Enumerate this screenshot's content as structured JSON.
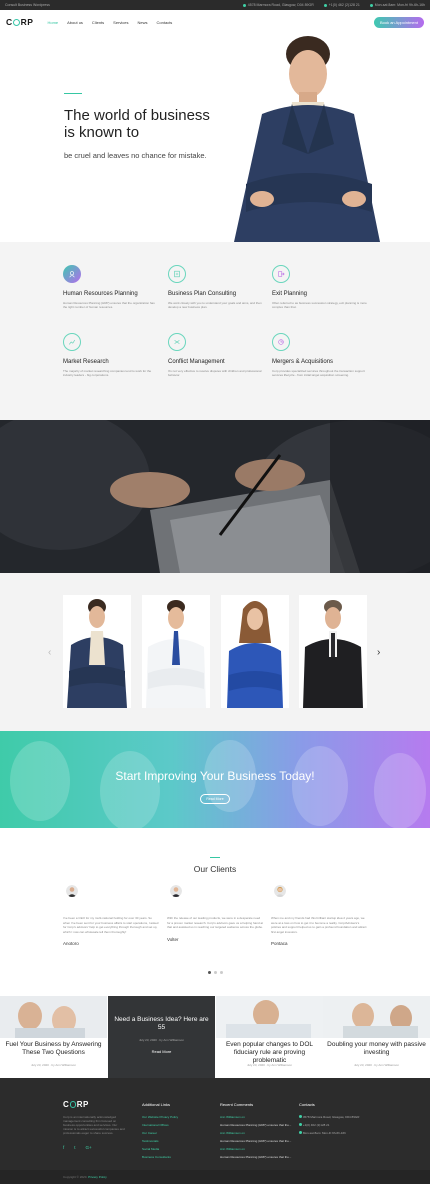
{
  "topbar": {
    "tagline": "Consult Business Wordpress",
    "address": "4578 Marmora Road, Glasgow, D04 89GR",
    "phone": "+1(0) 462 (2)128 21",
    "hours": "Mon-sat 8am: Mon-fri 9h-6h-16h",
    "accent": "#3fd0a6"
  },
  "header": {
    "logo": {
      "pre": "C",
      "post": "RP"
    },
    "nav": [
      "Home",
      "About us",
      "Clients",
      "Services",
      "News",
      "Contacts"
    ],
    "active_index": 0,
    "cta_label": "Book an Appointment"
  },
  "hero": {
    "title_line1": "The world of business",
    "title_line2": "is known to",
    "subtitle": "be cruel and leaves no chance for mistake."
  },
  "services": [
    {
      "icon": "people-icon",
      "title": "Human Resources Planning",
      "text": "Human Resources Planning (HRP) ensures that the organization has the right number of human resources.",
      "filled": true
    },
    {
      "icon": "document-icon",
      "title": "Business Plan Consulting",
      "text": "We work closely with you to understand your goals and aims, and then develop a new business plan.",
      "filled": false
    },
    {
      "icon": "exit-icon",
      "title": "Exit Planning",
      "text": "Often referred to as business succession strategy, exit planning is more complex than that.",
      "filled": false
    },
    {
      "icon": "chart-icon",
      "title": "Market Research",
      "text": "The majority of market researching companies tend to work for the industry leaders - big corporations.",
      "filled": false
    },
    {
      "icon": "conflict-icon",
      "title": "Conflict Management",
      "text": "It's not very effective to resolve disputes with children and professional behavior.",
      "filled": false
    },
    {
      "icon": "merge-icon",
      "title": "Mergers & Acquisitions",
      "text": "Corp provides specialized services throughout the transaction support services lifecycle - from initial target acquisition screening.",
      "filled": false
    }
  ],
  "team": {
    "prev_icon": "chevron-left-icon",
    "next_icon": "chevron-right-icon"
  },
  "cta": {
    "title": "Start Improving Your Business Today!",
    "button": "Read More"
  },
  "clients": {
    "title": "Our Clients",
    "items": [
      {
        "name": "Anotoro",
        "text": "I've been a CEO for my multi-national holding for over 30 years. So when I've been sent for your business affairs to start operations, I asked for Corp's advisors' help to get everything through thorough and set up, which I now can wholesale tell them thoroughly!"
      },
      {
        "name": "Volter",
        "text": "With the release of our leading products, we were in a desperate need for a proven market research. Corp's advisors gave us a helping hand at that and assisted us in reaching our targeted audience across the globe."
      },
      {
        "name": "Pontaca",
        "text": "When me and my friends had this brilliant startup idea 2 years ago, we were at a loss on how to get it to become a reality. Corp/Advisers's policies and support helped us to gain a profound foundation and attract first angel investors."
      }
    ]
  },
  "blog": [
    {
      "title": "Fuel Your Business by Answering These Two Questions",
      "meta": "July 23, 2020 · by Ann Williamson",
      "dark": false
    },
    {
      "title": "Need a Business Idea? Here are 55",
      "meta": "July 23, 2020 · by Ann Williamson",
      "read_more": "Read More",
      "dark": true
    },
    {
      "title": "Even popular changes to DOL fiduciary rule are proving problematic",
      "meta": "July 23, 2020 · by Ann Williamson",
      "dark": false
    },
    {
      "title": "Doubling your money with passive investing",
      "meta": "July 23, 2020 · by Ann Williamson",
      "dark": false
    }
  ],
  "footer": {
    "logo": {
      "pre": "C",
      "post": "RP"
    },
    "description": "Corp is an internationally acknowledged management consulting firm focused on business opportunities and services. Our mission is to attract successful companies and professionals eager to share success.",
    "links_title": "Additional Links",
    "links": [
      "Our Website Privacy Policy",
      "International Offices",
      "Our Career",
      "Testimonials",
      "Social Media",
      "Business Consultants"
    ],
    "comments_title": "Recent Comments",
    "comments": [
      {
        "author": "Ann Williamson on",
        "post": "Human Resources Planning (HRP) ensures that the..."
      },
      {
        "author": "Ann Williamson on",
        "post": "Human Resources Planning (HRP) ensures that the..."
      },
      {
        "author": "Ann Williamson on",
        "post": "Human Resources Planning (HRP) ensures that the..."
      }
    ],
    "contacts_title": "Contacts",
    "contacts": [
      "4578 Marmora Road, Glasgow, D04 89GR",
      "+1(0) 462 (2)128 21",
      "Mon-sat 8am: Mon-fri 9h-6h-16h"
    ],
    "copyright": "Copyright © 2020.",
    "privacy": "Privacy Policy"
  }
}
